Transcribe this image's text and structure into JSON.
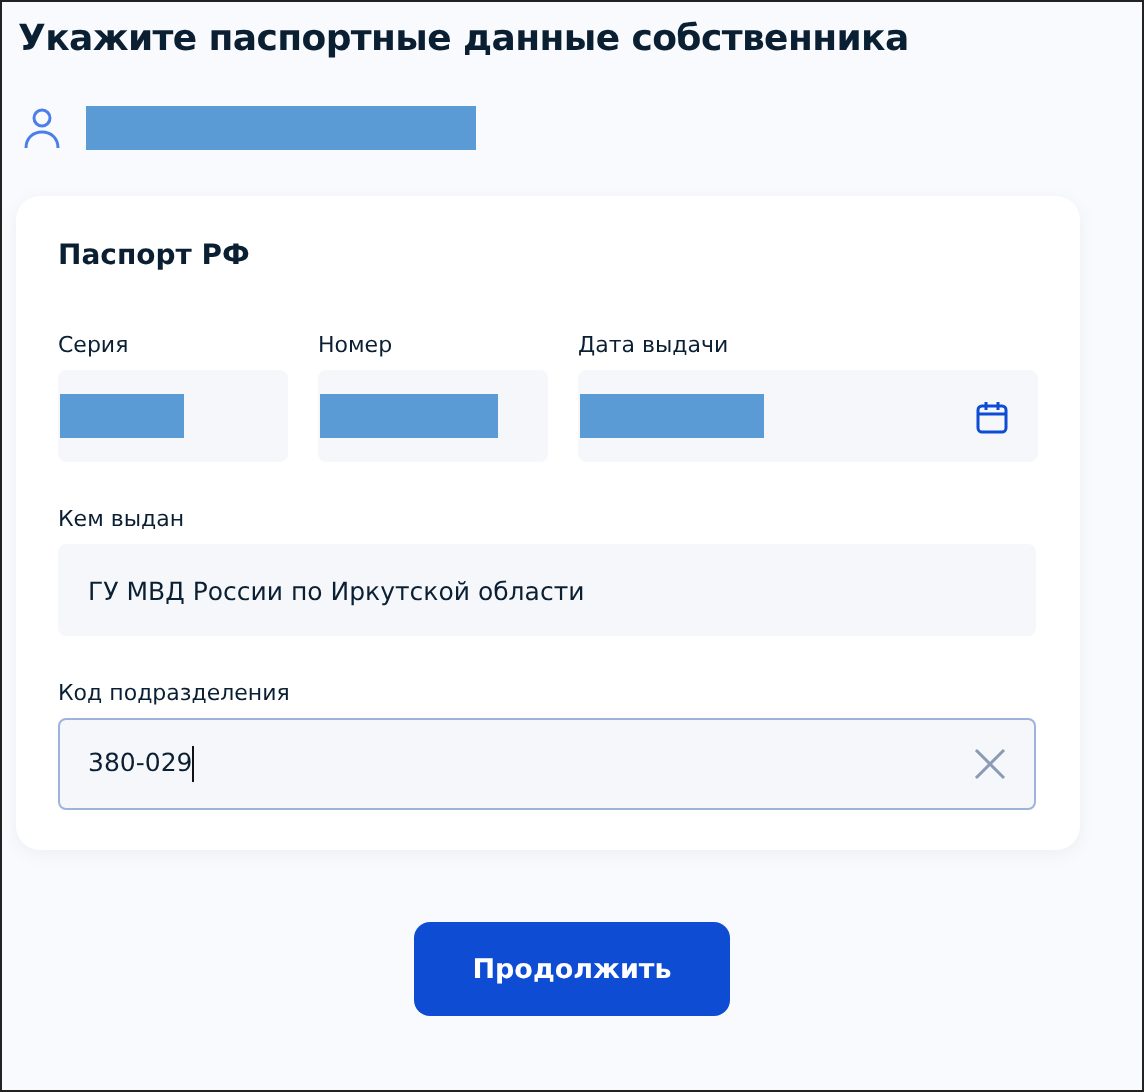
{
  "title": "Укажите паспортные данные собственника",
  "owner": {
    "name_redacted": true
  },
  "card": {
    "title": "Паспорт РФ",
    "rows": [
      [
        {
          "label": "Серия",
          "kind": "text",
          "redacted": true,
          "focused": false
        },
        {
          "label": "Номер",
          "kind": "text",
          "redacted": true,
          "focused": false
        },
        {
          "label": "Дата выдачи",
          "kind": "date",
          "redacted": true,
          "focused": false
        }
      ],
      [
        {
          "label": "Кем выдан",
          "kind": "text",
          "redacted": false,
          "value": "ГУ МВД России по Иркутской области",
          "focused": false
        }
      ],
      [
        {
          "label": "Код подразделения",
          "kind": "text",
          "redacted": false,
          "value": "380-029",
          "focused": true
        }
      ]
    ]
  },
  "button": "Продолжить"
}
